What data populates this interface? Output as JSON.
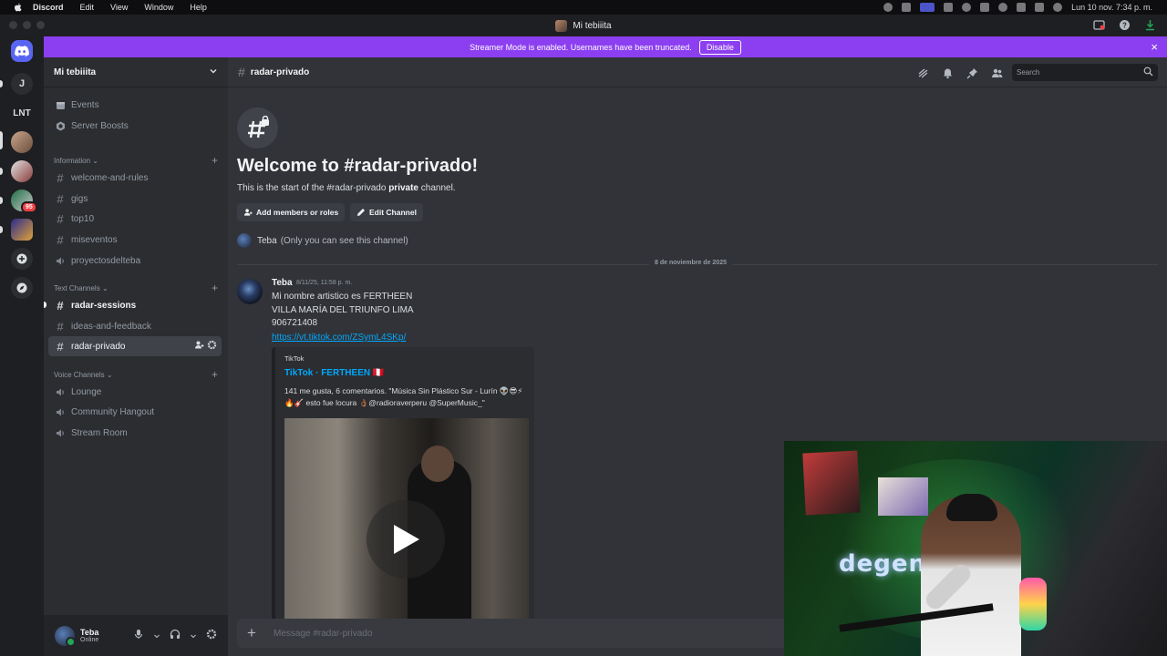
{
  "menubar": {
    "app": "Discord",
    "items": [
      "Edit",
      "View",
      "Window",
      "Help"
    ],
    "clock": "Lun 10 nov.  7:34 p. m."
  },
  "window": {
    "title": "Mi tebiiita"
  },
  "banner": {
    "text": "Streamer Mode is enabled. Usernames have been truncated.",
    "disable_label": "Disable",
    "color": "#8c3ff0"
  },
  "rail": {
    "servers": [
      {
        "label": "J"
      },
      {
        "label": "LNT"
      }
    ],
    "badge": "95"
  },
  "sidebar": {
    "guild_name": "Mi tebiiita",
    "top_items": [
      {
        "label": "Events",
        "icon": "calendar-icon"
      },
      {
        "label": "Server Boosts",
        "icon": "boost-icon"
      }
    ],
    "categories": [
      {
        "label": "Information",
        "channels": [
          {
            "label": "welcome-and-rules",
            "type": "text"
          },
          {
            "label": "gigs",
            "type": "text"
          },
          {
            "label": "top10",
            "type": "text"
          },
          {
            "label": "miseventos",
            "type": "text"
          },
          {
            "label": "proyectosdelteba",
            "type": "voice"
          }
        ]
      },
      {
        "label": "Text Channels",
        "channels": [
          {
            "label": "radar-sessions",
            "type": "text",
            "unread": true
          },
          {
            "label": "ideas-and-feedback",
            "type": "text"
          },
          {
            "label": "radar-privado",
            "type": "text",
            "selected": true
          }
        ]
      },
      {
        "label": "Voice Channels",
        "channels": [
          {
            "label": "Lounge",
            "type": "voice"
          },
          {
            "label": "Community Hangout",
            "type": "voice"
          },
          {
            "label": "Stream Room",
            "type": "voice"
          }
        ]
      }
    ]
  },
  "user": {
    "name": "Teba",
    "status": "Online"
  },
  "chat": {
    "channel_name": "radar-privado",
    "search_placeholder": "Search",
    "welcome_title": "Welcome to #radar-privado!",
    "welcome_sub_pre": "This is the start of the #radar-privado ",
    "welcome_sub_bold": "private",
    "welcome_sub_post": " channel.",
    "add_members_label": "Add members or roles",
    "edit_channel_label": "Edit Channel",
    "only_you_name": "Teba",
    "only_you_text": "(Only you can see this channel)",
    "date_divider": "8 de noviembre de 2025",
    "message": {
      "author": "Teba",
      "time": "8/11/25, 11:58 p. m.",
      "lines": [
        "Mi nombre artistico es FERTHEEN",
        "VILLA MARÍA DEL TRIUNFO LIMA",
        "906721408"
      ],
      "link": "https://vt.tiktok.com/ZSymL4SKp/",
      "embed": {
        "provider": "TikTok",
        "title": "TikTok · FERTHEEN 🇵🇪",
        "description": "141 me gusta, 6 comentarios. \"Música Sin Plástico Sur - Lurín 👽😎⚡🔥🎸 esto fue locura 👌🏾@radioraverperu @SuperMusic_\""
      }
    },
    "composer_placeholder": "Message #radar-privado"
  },
  "webcam": {
    "neon_text": "degenere"
  }
}
